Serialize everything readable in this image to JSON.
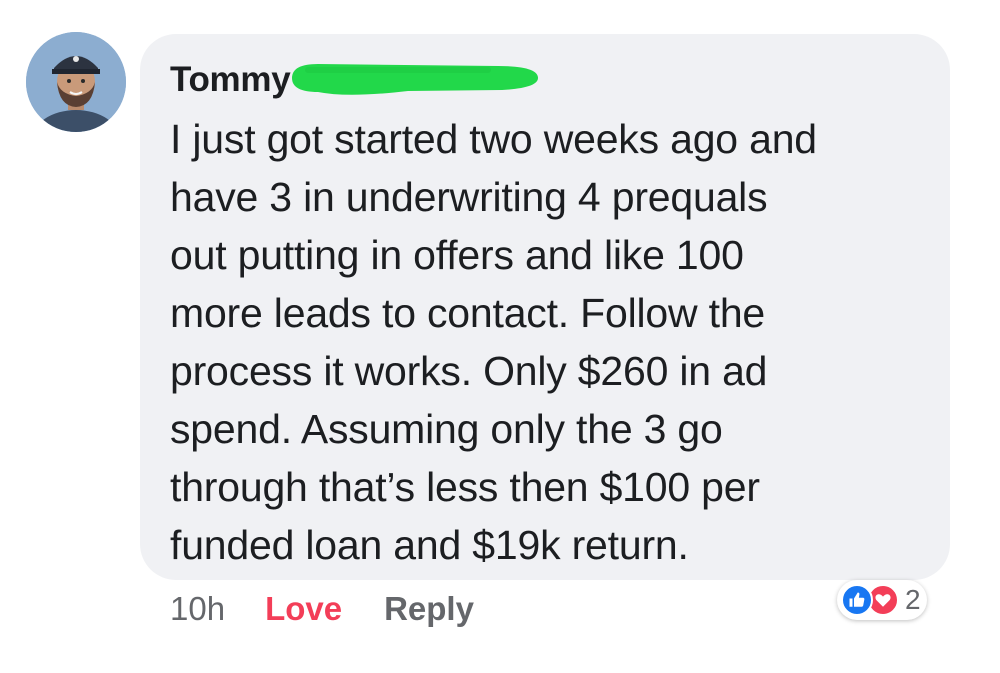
{
  "comment": {
    "author": "Tommy",
    "text_lines": [
      "I just got started two weeks ago and",
      "have 3 in underwriting 4 prequals",
      "out putting in offers and like 100",
      "more leads to contact. Follow the",
      "process it works. Only $260 in ad",
      "spend. Assuming only the 3 go",
      "through that’s less then $100 per",
      "funded loan and $19k return."
    ],
    "timestamp": "10h",
    "love_label": "Love",
    "reply_label": "Reply",
    "reaction_count": "2",
    "reaction_icons": [
      "like-icon",
      "love-icon"
    ]
  },
  "colors": {
    "bubble": "#f0f1f4",
    "love": "#f33e58",
    "like": "#1877f2",
    "redaction": "#22d84a",
    "meta_text": "#65676b"
  }
}
